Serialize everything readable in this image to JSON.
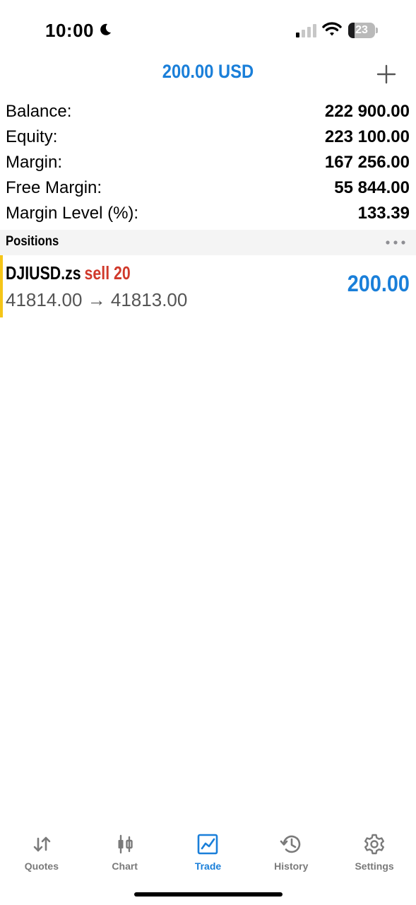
{
  "status_bar": {
    "time": "10:00",
    "battery_level": "23",
    "battery_fraction": 0.23,
    "moon_icon": "moon-icon",
    "signal_icon": "cellular-signal-icon",
    "wifi_icon": "wifi-icon"
  },
  "header": {
    "title": "200.00 USD",
    "add_icon": "plus-icon"
  },
  "summary": [
    {
      "label": "Balance:",
      "value": "222 900.00"
    },
    {
      "label": "Equity:",
      "value": "223 100.00"
    },
    {
      "label": "Margin:",
      "value": "167 256.00"
    },
    {
      "label": "Free Margin:",
      "value": "55 844.00"
    },
    {
      "label": "Margin Level (%):",
      "value": "133.39"
    }
  ],
  "positions": {
    "title": "Positions",
    "more_icon": "more-icon",
    "items": [
      {
        "symbol": "DJIUSD.zs",
        "side": "sell 20",
        "prices": "41814.00 → 41813.00",
        "profit": "200.00"
      }
    ]
  },
  "tabs": [
    {
      "label": "Quotes",
      "icon": "quotes-icon",
      "active": false
    },
    {
      "label": "Chart",
      "icon": "chart-icon",
      "active": false
    },
    {
      "label": "Trade",
      "icon": "trade-icon",
      "active": true
    },
    {
      "label": "History",
      "icon": "history-icon",
      "active": false
    },
    {
      "label": "Settings",
      "icon": "settings-icon",
      "active": false
    }
  ],
  "colors": {
    "accent": "#1a7fd9",
    "sell": "#d0392b",
    "position_marker": "#f5c518",
    "section_bg": "#f4f4f4",
    "inactive_tab": "#7a7a7a"
  }
}
